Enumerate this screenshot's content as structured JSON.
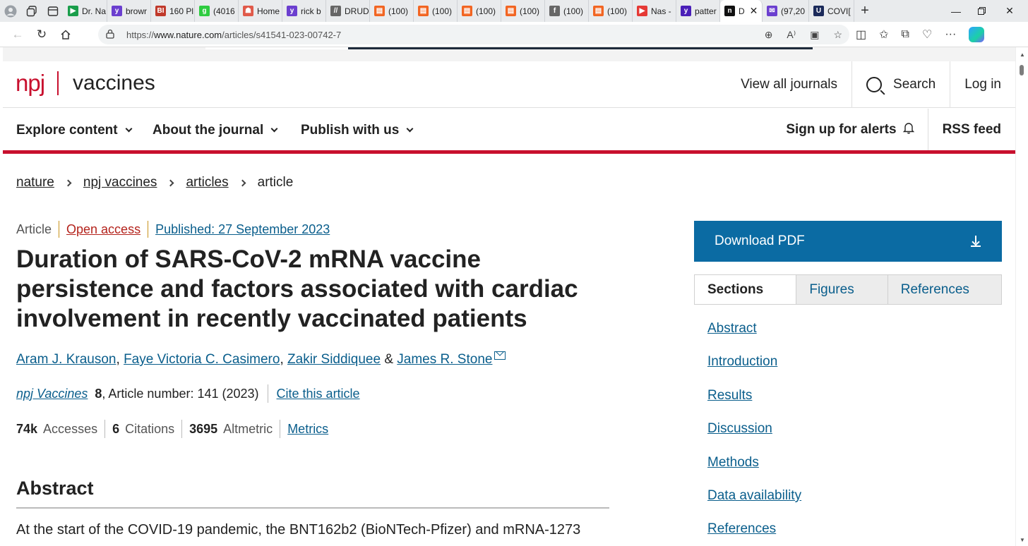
{
  "browser": {
    "tabs": [
      {
        "label": "Dr. Na",
        "fav_color": "#1a9e4b",
        "fav_glyph": "▶"
      },
      {
        "label": "browr",
        "fav_color": "#6b3fcf",
        "fav_glyph": "y"
      },
      {
        "label": "160 Pl",
        "fav_color": "#c0392b",
        "fav_glyph": "BI"
      },
      {
        "label": "(4016",
        "fav_color": "#2ecc40",
        "fav_glyph": "g"
      },
      {
        "label": "Home",
        "fav_color": "#e05a4a",
        "fav_glyph": "☗"
      },
      {
        "label": "rick b",
        "fav_color": "#6b3fcf",
        "fav_glyph": "y"
      },
      {
        "label": "DRUD",
        "fav_color": "#666666",
        "fav_glyph": "//"
      },
      {
        "label": "(100)",
        "fav_color": "#f26522",
        "fav_glyph": "▤"
      },
      {
        "label": "(100)",
        "fav_color": "#f26522",
        "fav_glyph": "▤"
      },
      {
        "label": "(100)",
        "fav_color": "#f26522",
        "fav_glyph": "▤"
      },
      {
        "label": "(100)",
        "fav_color": "#f26522",
        "fav_glyph": "▤"
      },
      {
        "label": "(100)",
        "fav_color": "#666666",
        "fav_glyph": "f"
      },
      {
        "label": "(100)",
        "fav_color": "#f26522",
        "fav_glyph": "▤"
      },
      {
        "label": "Nas -",
        "fav_color": "#e53935",
        "fav_glyph": "▶"
      },
      {
        "label": "patter",
        "fav_color": "#4a1fb8",
        "fav_glyph": "y"
      },
      {
        "label": "D",
        "fav_color": "#111111",
        "fav_glyph": "n",
        "active": true
      },
      {
        "label": "(97,20",
        "fav_color": "#6b3fcf",
        "fav_glyph": "✉"
      },
      {
        "label": "COVI[",
        "fav_color": "#1b2a5a",
        "fav_glyph": "U"
      }
    ],
    "url_scheme": "https://",
    "url_host": "www.nature.com",
    "url_path": "/articles/s41541-023-00742-7"
  },
  "journal": {
    "logo_npj": "npj",
    "logo_name": "vaccines",
    "header_links": [
      "View all journals",
      "Search",
      "Log in"
    ],
    "menu": [
      "Explore content",
      "About the journal",
      "Publish with us"
    ],
    "alerts": "Sign up for alerts",
    "rss": "RSS feed"
  },
  "breadcrumb": [
    "nature",
    "npj vaccines",
    "articles",
    "article"
  ],
  "article": {
    "type": "Article",
    "access": "Open access",
    "published": "Published: 27 September 2023",
    "title": "Duration of SARS-CoV-2 mRNA vaccine persistence and factors associated with cardiac involvement in recently vaccinated patients",
    "authors": [
      "Aram J. Krauson",
      "Faye Victoria C. Casimero",
      "Zakir Siddiquee",
      "James R. Stone"
    ],
    "author_sep1": ", ",
    "author_sep2": ", ",
    "author_sep3": " & ",
    "journal_name": "npj Vaccines",
    "volume": "8",
    "article_number": ", Article number: 141 (2023)",
    "cite": "Cite this article",
    "accesses_value": "74k",
    "accesses_label": "Accesses",
    "citations_value": "6",
    "citations_label": "Citations",
    "altmetric_value": "3695",
    "altmetric_label": "Altmetric",
    "metrics_link": "Metrics",
    "abstract_heading": "Abstract",
    "abstract_text": "At the start of the COVID-19 pandemic, the BNT162b2 (BioNTech-Pfizer) and mRNA-1273"
  },
  "sidebar": {
    "download": "Download PDF",
    "tabs": [
      "Sections",
      "Figures",
      "References"
    ],
    "sections": [
      "Abstract",
      "Introduction",
      "Results",
      "Discussion",
      "Methods",
      "Data availability",
      "References"
    ]
  }
}
